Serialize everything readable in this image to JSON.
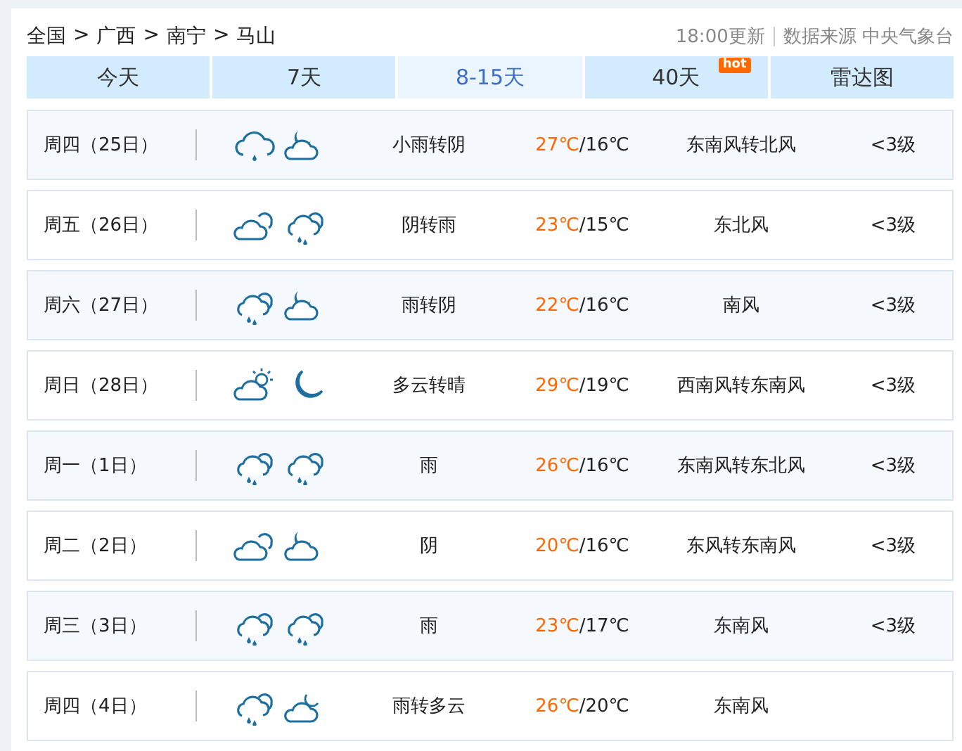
{
  "breadcrumb": [
    "全国",
    "广西",
    "南宁",
    "马山"
  ],
  "breadcrumb_separator": ">",
  "update_time": "18:00更新",
  "data_source": "数据来源 中央气象台",
  "tabs": [
    {
      "label": "今天",
      "selected": false
    },
    {
      "label": "7天",
      "selected": false
    },
    {
      "label": "8-15天",
      "selected": true
    },
    {
      "label": "40天",
      "selected": false,
      "badge": "hot"
    },
    {
      "label": "雷达图",
      "selected": false
    }
  ],
  "days": [
    {
      "day": "周四（25日）",
      "icons": [
        {
          "kind": "lightrain"
        },
        {
          "kind": "nightcloud"
        }
      ],
      "weather": "小雨转阴",
      "high": "27℃",
      "low": "/16℃",
      "wind": "东南风转北风",
      "level": "<3级"
    },
    {
      "day": "周五（26日）",
      "icons": [
        {
          "kind": "overcast"
        },
        {
          "kind": "rain"
        }
      ],
      "weather": "阴转雨",
      "high": "23℃",
      "low": "/15℃",
      "wind": "东北风",
      "level": "<3级"
    },
    {
      "day": "周六（27日）",
      "icons": [
        {
          "kind": "rain"
        },
        {
          "kind": "nightcloud"
        }
      ],
      "weather": "雨转阴",
      "high": "22℃",
      "low": "/16℃",
      "wind": "南风",
      "level": "<3级"
    },
    {
      "day": "周日（28日）",
      "icons": [
        {
          "kind": "daycloud"
        },
        {
          "kind": "moon"
        }
      ],
      "weather": "多云转晴",
      "high": "29℃",
      "low": "/19℃",
      "wind": "西南风转东南风",
      "level": "<3级"
    },
    {
      "day": "周一（1日）",
      "icons": [
        {
          "kind": "rain"
        },
        {
          "kind": "rain"
        }
      ],
      "weather": "雨",
      "high": "26℃",
      "low": "/16℃",
      "wind": "东南风转东北风",
      "level": "<3级"
    },
    {
      "day": "周二（2日）",
      "icons": [
        {
          "kind": "overcast"
        },
        {
          "kind": "nightcloud"
        }
      ],
      "weather": "阴",
      "high": "20℃",
      "low": "/16℃",
      "wind": "东风转东南风",
      "level": "<3级"
    },
    {
      "day": "周三（3日）",
      "icons": [
        {
          "kind": "rain"
        },
        {
          "kind": "rain"
        }
      ],
      "weather": "雨",
      "high": "23℃",
      "low": "/17℃",
      "wind": "东南风",
      "level": "<3级"
    },
    {
      "day": "周四（4日）",
      "icons": [
        {
          "kind": "rain"
        },
        {
          "kind": "nightcloudsmall"
        }
      ],
      "weather": "雨转多云",
      "high": "26℃",
      "low": "/20℃",
      "wind": "东南风"
    }
  ]
}
